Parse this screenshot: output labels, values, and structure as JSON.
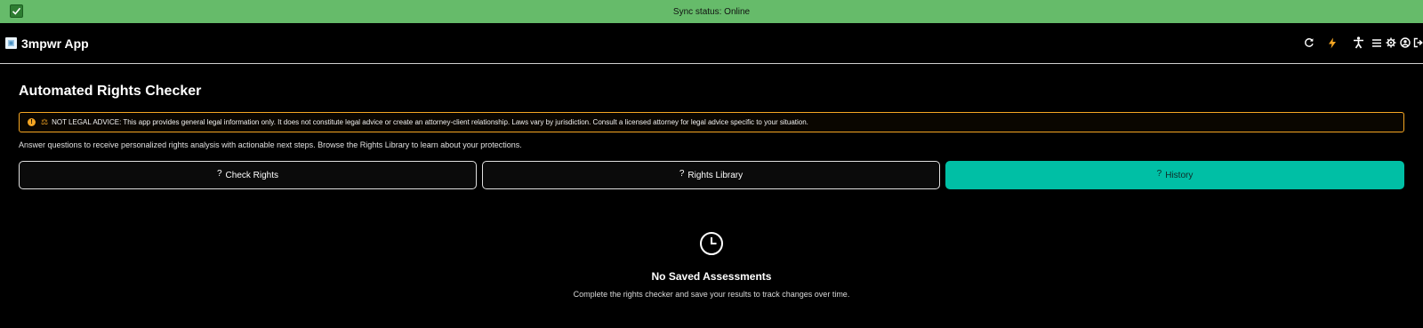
{
  "sync": {
    "status_text": "Sync status: Online",
    "check_icon": "checkmark-icon",
    "bar_color": "#66bb6a"
  },
  "header": {
    "app_name": "3mpwr App",
    "icons": [
      "refresh-icon",
      "lightning-icon",
      "accessibility-icon",
      "menu-icon",
      "gear-icon",
      "user-icon",
      "logout-icon"
    ],
    "accent_color": "#f5a623"
  },
  "main": {
    "title": "Automated Rights Checker",
    "disclaimer": "NOT LEGAL ADVICE: This app provides general legal information only. It does not constitute legal advice or create an attorney-client relationship. Laws vary by jurisdiction. Consult a licensed attorney for legal advice specific to your situation.",
    "intro": "Answer questions to receive personalized rights analysis with actionable next steps. Browse the Rights Library to learn about your protections.",
    "tabs": [
      {
        "glyph": "?",
        "label": "Check Rights",
        "active": false
      },
      {
        "glyph": "?",
        "label": "Rights Library",
        "active": false
      },
      {
        "glyph": "?",
        "label": "History",
        "active": true
      }
    ],
    "active_tab_color": "#00bfa5",
    "empty_state": {
      "icon": "clock-icon",
      "title": "No Saved Assessments",
      "subtitle": "Complete the rights checker and save your results to track changes over time."
    }
  }
}
